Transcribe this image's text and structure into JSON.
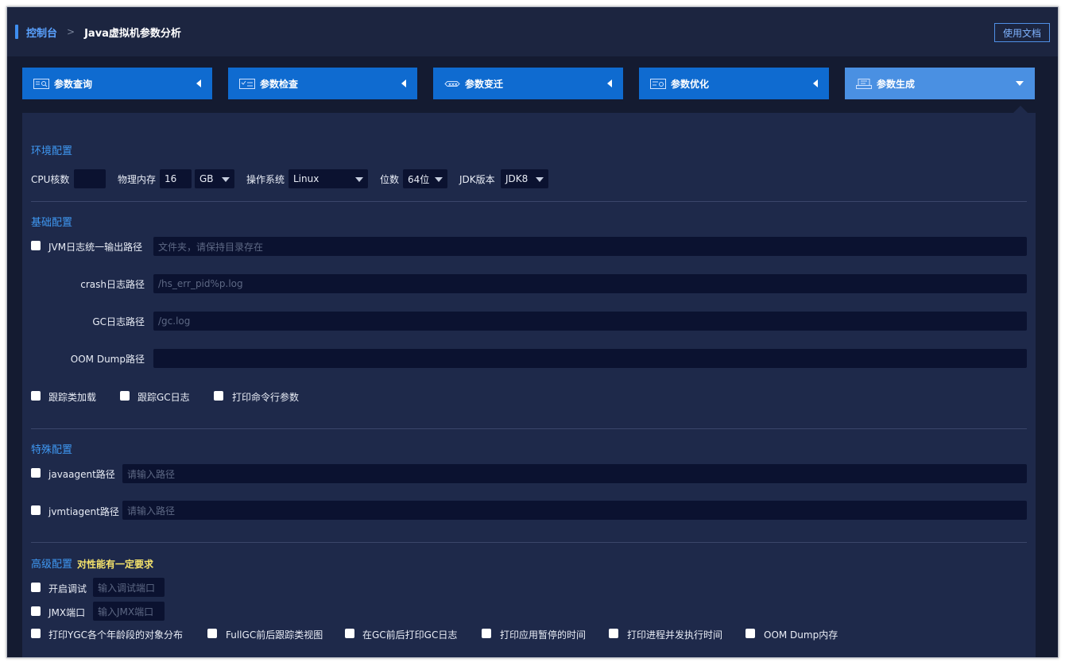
{
  "header": {
    "breadcrumb_root": "控制台",
    "breadcrumb_sep": ">",
    "breadcrumb_current": "Java虚拟机参数分析",
    "doc_button": "使用文档"
  },
  "tabs": [
    {
      "label": "参数查询",
      "icon": "search-doc-icon",
      "state": "collapsed"
    },
    {
      "label": "参数检查",
      "icon": "checklist-icon",
      "state": "collapsed"
    },
    {
      "label": "参数变迁",
      "icon": "transition-icon",
      "state": "collapsed"
    },
    {
      "label": "参数优化",
      "icon": "optimize-icon",
      "state": "collapsed"
    },
    {
      "label": "参数生成",
      "icon": "generate-icon",
      "state": "expanded"
    }
  ],
  "env": {
    "title": "环境配置",
    "cpu_label": "CPU核数",
    "cpu_value": "",
    "mem_label": "物理内存",
    "mem_value": "16",
    "mem_unit": "GB",
    "os_label": "操作系统",
    "os_value": "Linux",
    "bits_label": "位数",
    "bits_value": "64位",
    "jdk_label": "JDK版本",
    "jdk_value": "JDK8"
  },
  "basic": {
    "title": "基础配置",
    "jvm_log_label": "JVM日志统一输出路径",
    "jvm_log_placeholder": "文件夹，请保持目录存在",
    "crash_label": "crash日志路径",
    "crash_placeholder": "/hs_err_pid%p.log",
    "gc_label": "GC日志路径",
    "gc_placeholder": "/gc.log",
    "oom_label": "OOM Dump路径",
    "oom_value": "",
    "trace_class_label": "跟踪类加载",
    "trace_gc_label": "跟踪GC日志",
    "print_cmd_label": "打印命令行参数"
  },
  "special": {
    "title": "特殊配置",
    "javaagent_label": "javaagent路径",
    "javaagent_placeholder": "请输入路径",
    "jvmtiagent_label": "jvmtiagent路径",
    "jvmtiagent_placeholder": "请输入路径"
  },
  "advanced": {
    "title": "高级配置",
    "note": "对性能有一定要求",
    "debug_label": "开启调试",
    "debug_placeholder": "输入调试端口",
    "jmx_label": "JMX端口",
    "jmx_placeholder": "输入JMX端口",
    "options": [
      "打印YGC各个年龄段的对象分布",
      "FullGC前后跟踪类视图",
      "在GC前后打印GC日志",
      "打印应用暂停的时间",
      "打印进程并发执行时间",
      "OOM Dump内存"
    ]
  }
}
